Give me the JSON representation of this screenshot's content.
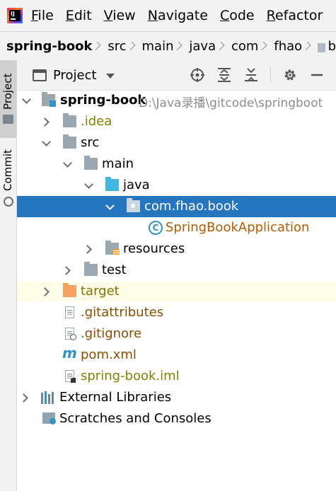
{
  "menubar": {
    "items": [
      {
        "label": "File",
        "mnemonic": "F"
      },
      {
        "label": "Edit",
        "mnemonic": "E"
      },
      {
        "label": "View",
        "mnemonic": "V"
      },
      {
        "label": "Navigate",
        "mnemonic": "N"
      },
      {
        "label": "Code",
        "mnemonic": "C"
      },
      {
        "label": "Refactor",
        "mnemonic": "R"
      }
    ]
  },
  "breadcrumb": {
    "items": [
      "spring-book",
      "src",
      "main",
      "java",
      "com",
      "fhao"
    ],
    "trailing": "b"
  },
  "sidebar": {
    "project_tab": "Project",
    "commit_tab": "Commit"
  },
  "toolwindow": {
    "title": "Project",
    "tools": [
      "locate-icon",
      "expand-all-icon",
      "collapse-all-icon",
      "gear-icon",
      "minimize-icon"
    ]
  },
  "tree": {
    "root_label": "spring-book",
    "root_path": "D:\\Java录播\\gitcode\\springboot",
    "idea": ".idea",
    "src": "src",
    "main": "main",
    "java": "java",
    "package": "com.fhao.book",
    "app_class": "SpringBookApplication",
    "resources": "resources",
    "test": "test",
    "target": "target",
    "gitattributes": ".gitattributes",
    "gitignore": ".gitignore",
    "pom": "pom.xml",
    "iml": "spring-book.iml",
    "external_libraries": "External Libraries",
    "scratches": "Scratches and Consoles"
  },
  "colors": {
    "selection": "#2675bf",
    "ignored_file": "#8c4d00",
    "excluded_text": "#8a6e00",
    "module_text": "#808000",
    "class_text": "#b75a00"
  }
}
